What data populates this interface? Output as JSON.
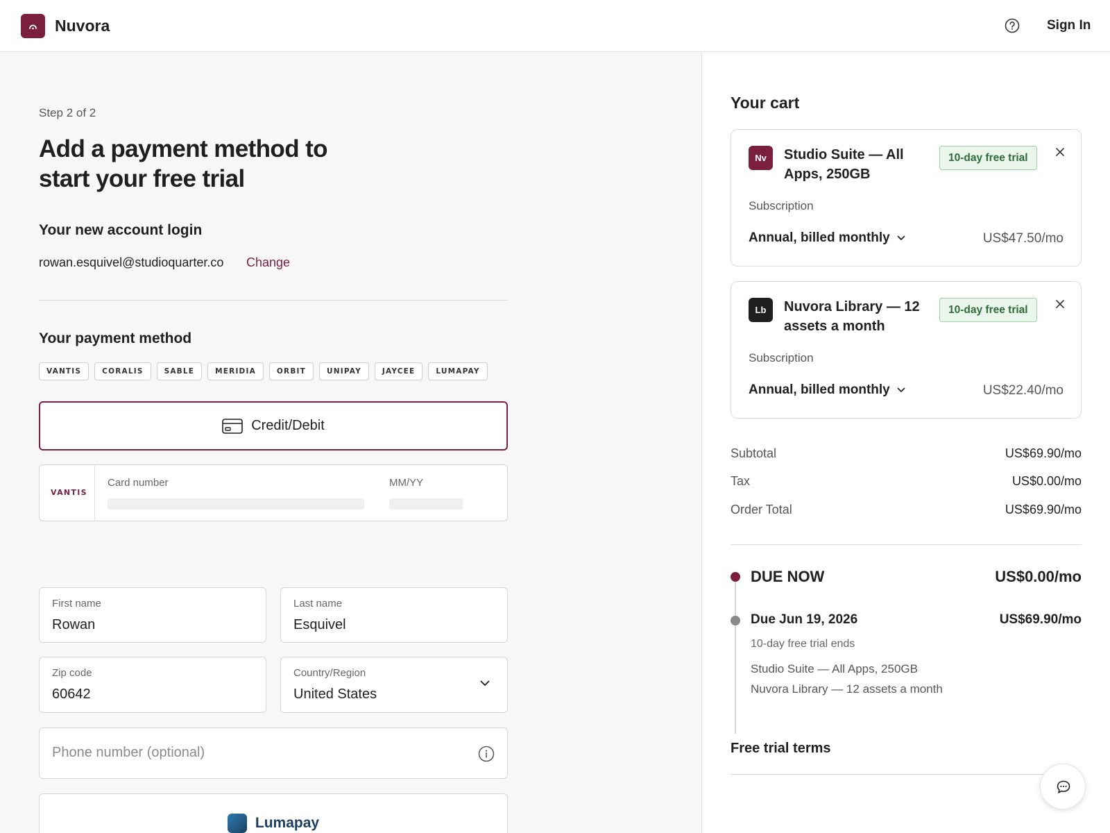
{
  "header": {
    "brand": "Nuvora",
    "sign_in": "Sign In"
  },
  "checkout": {
    "step": "Step 2 of 2",
    "title": "Add a payment method to start your free trial",
    "account_heading": "Your new account login",
    "account_email": "rowan.esquivel@studioquarter.co",
    "change_link": "Change",
    "payment_heading": "Your payment method",
    "card_brands": [
      "VANTIS",
      "CORALIS",
      "SABLE",
      "MERIDIA",
      "ORBIT",
      "UNIPAY",
      "JAYCEE",
      "LUMAPAY"
    ],
    "credit_debit_label": "Credit/Debit",
    "card": {
      "brand": "VANTIS",
      "number_label": "Card number",
      "expiry_label": "MM/YY"
    },
    "first_name": {
      "label": "First name",
      "value": "Rowan"
    },
    "last_name": {
      "label": "Last name",
      "value": "Esquivel"
    },
    "zip": {
      "label": "Zip code",
      "value": "60642"
    },
    "country": {
      "label": "Country/Region",
      "value": "United States"
    },
    "phone": {
      "placeholder": "Phone number (optional)"
    },
    "alt_pay_label": "Lumapay"
  },
  "cart": {
    "heading": "Your cart",
    "items": [
      {
        "icon_text": "Nv",
        "name": "Studio Suite — All Apps, 250GB",
        "badge": "10-day free trial",
        "sub_label": "Subscription",
        "plan": "Annual, billed monthly",
        "price": "US$47.50/mo"
      },
      {
        "icon_text": "Lb",
        "name": "Nuvora Library — 12 assets a month",
        "badge": "10-day free trial",
        "sub_label": "Subscription",
        "plan": "Annual, billed monthly",
        "price": "US$22.40/mo"
      }
    ],
    "summary": {
      "subtotal_label": "Subtotal",
      "subtotal": "US$69.90/mo",
      "tax_label": "Tax",
      "tax": "US$0.00/mo",
      "total_label": "Order Total",
      "total": "US$69.90/mo"
    },
    "due_now": {
      "label": "DUE NOW",
      "amount": "US$0.00/mo"
    },
    "due_later": {
      "label": "Due Jun 19, 2026",
      "amount": "US$69.90/mo",
      "note": "10-day free trial ends",
      "items": [
        "Studio Suite — All Apps, 250GB",
        "Nuvora Library — 12 assets a month"
      ]
    },
    "terms": "Free trial terms"
  },
  "colors": {
    "brand": "#7a1f3d",
    "trial_badge_bg": "#eaf6ec",
    "trial_badge_text": "#2f6b3a",
    "lumapay": "#1c3f63"
  }
}
